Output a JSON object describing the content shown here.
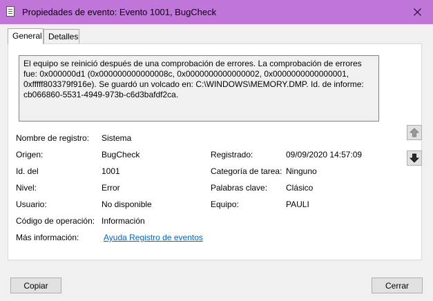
{
  "window": {
    "title": "Propiedades de evento: Evento 1001, BugCheck"
  },
  "tabs": [
    {
      "label": "General",
      "active": true
    },
    {
      "label": "Detalles",
      "active": false
    }
  ],
  "description": "El equipo se reinició después de una comprobación de errores. La comprobación de errores fue: 0x000000d1 (0x000000000000008c, 0x0000000000000002, 0x0000000000000001, 0xfffff803379f916e). Se guardó un volcado en: C:\\WINDOWS\\MEMORY.DMP. Id. de informe: cb066860-5531-4949-973b-c6d3bafdf2ca.",
  "fields": {
    "log_name": {
      "label": "Nombre de registro:",
      "value": "Sistema"
    },
    "source": {
      "label": "Origen:",
      "value": "BugCheck"
    },
    "logged": {
      "label": "Registrado:",
      "value": "09/09/2020 14:57:09"
    },
    "event_id": {
      "label": "Id. del",
      "value": "1001"
    },
    "task_category": {
      "label": "Categoría de tarea:",
      "value": "Ninguno"
    },
    "level": {
      "label": "Nivel:",
      "value": "Error"
    },
    "keywords": {
      "label": "Palabras clave:",
      "value": "Clásico"
    },
    "user": {
      "label": "Usuario:",
      "value": "No disponible"
    },
    "computer": {
      "label": "Equipo:",
      "value": "PAULI"
    },
    "opcode": {
      "label": "Código de operación:",
      "value": "Información"
    },
    "more_info": {
      "label": "Más información:",
      "value": "Ayuda Registro de eventos"
    }
  },
  "buttons": {
    "copy": "Copiar",
    "close": "Cerrar"
  },
  "icons": {
    "title": "event-properties-icon",
    "close": "close-icon",
    "up": "arrow-up-icon",
    "down": "arrow-down-icon"
  },
  "colors": {
    "titlebar": "#c075d8",
    "link": "#0066cc"
  }
}
